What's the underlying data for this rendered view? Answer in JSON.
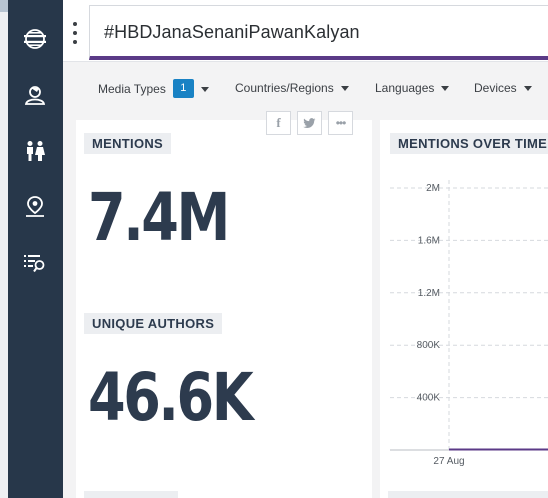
{
  "search": {
    "query": "#HBDJanaSenaniPawanKalyan"
  },
  "sidebar": {
    "items": [
      {
        "icon": "stack-globe-icon"
      },
      {
        "icon": "user-profile-icon"
      },
      {
        "icon": "demographics-icon"
      },
      {
        "icon": "location-pin-icon"
      },
      {
        "icon": "list-search-icon"
      }
    ]
  },
  "filters": {
    "media_types": {
      "label": "Media Types",
      "count": "1"
    },
    "countries": {
      "label": "Countries/Regions"
    },
    "languages": {
      "label": "Languages"
    },
    "devices": {
      "label": "Devices"
    }
  },
  "share": {
    "buttons": [
      "facebook-icon",
      "twitter-icon",
      "more-icon"
    ]
  },
  "metrics": {
    "mentions": {
      "label": "MENTIONS",
      "value": "7.4M"
    },
    "unique_authors": {
      "label": "UNIQUE AUTHORS",
      "value": "46.6K"
    }
  },
  "chart_panel": {
    "title": "MENTIONS OVER TIME"
  },
  "chart_data": {
    "type": "line",
    "title": "MENTIONS OVER TIME",
    "y_ticks": [
      "2M",
      "1.6M",
      "1.2M",
      "800K",
      "400K"
    ],
    "y_tick_values": [
      2000000,
      1600000,
      1200000,
      800000,
      400000
    ],
    "x_ticks": [
      "27 Aug"
    ],
    "ylim": [
      0,
      2000000
    ],
    "grid": true,
    "series_color": "#5b3a87"
  },
  "colors": {
    "sidebar": "#27374a",
    "accent": "#5b3a87",
    "badge": "#1982c4",
    "metric_text": "#2d3b4e"
  }
}
